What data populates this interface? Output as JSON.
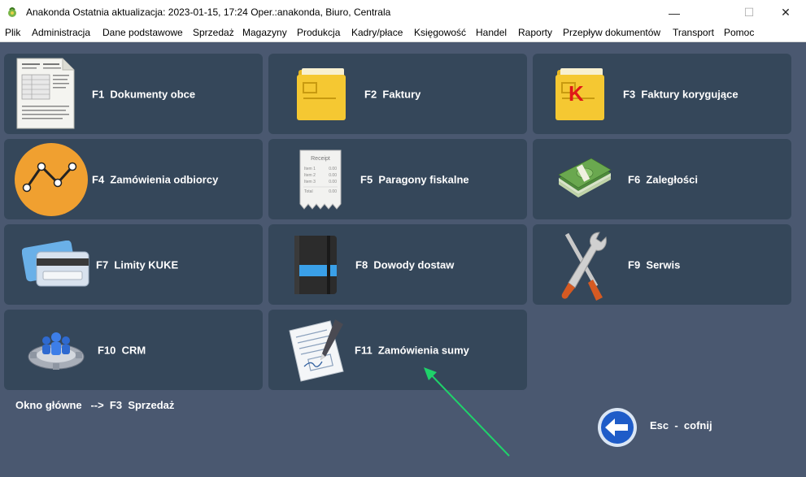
{
  "window": {
    "title": "Anakonda Ostatnia aktualizacja: 2023-01-15, 17:24 Oper.:anakonda, Biuro, Centrala",
    "minimize": "—",
    "maximize": "☐",
    "close": "✕"
  },
  "menu": [
    "Plik",
    "Administracja",
    "Dane podstawowe",
    "Sprzedaż",
    "Magazyny",
    "Produkcja",
    "Kadry/płace",
    "Księgowość",
    "Handel",
    "Raporty",
    "Przepływ dokumentów",
    "Transport",
    "Pomoc"
  ],
  "tiles": [
    {
      "label": "F1  Dokumenty obce",
      "icon": "document-icon"
    },
    {
      "label": "F2  Faktury",
      "icon": "folder-icon"
    },
    {
      "label": "F3  Faktury korygujące",
      "icon": "folder-correction-icon",
      "icon_letter": "K"
    },
    {
      "label": "F4  Zamówienia odbiorcy",
      "icon": "line-chart-icon"
    },
    {
      "label": "F5  Paragony fiskalne",
      "icon": "receipt-icon",
      "receipt_title": "Receipt",
      "receipt_lines": [
        "Item 1",
        "Item 2",
        "Item 3",
        "Total"
      ],
      "receipt_values": [
        "0.00",
        "0.00",
        "0.00",
        "0.00"
      ]
    },
    {
      "label": "F6  Zaległości",
      "icon": "money-icon"
    },
    {
      "label": "F7  Limity KUKE",
      "icon": "credit-card-icon"
    },
    {
      "label": "F8  Dowody dostaw",
      "icon": "notebook-icon"
    },
    {
      "label": "F9  Serwis",
      "icon": "tools-icon"
    },
    {
      "label": "F10  CRM",
      "icon": "crm-gear-icon"
    },
    {
      "label": "F11  Zamówienia sumy",
      "icon": "contract-pen-icon"
    }
  ],
  "status": {
    "breadcrumb": "Okno główne   -->  F3  Sprzedaż"
  },
  "esc": {
    "label": "Esc  -  cofnij"
  },
  "colors": {
    "background": "#4a5870",
    "tile": "#35475a",
    "arrow": "#1fd26a"
  }
}
